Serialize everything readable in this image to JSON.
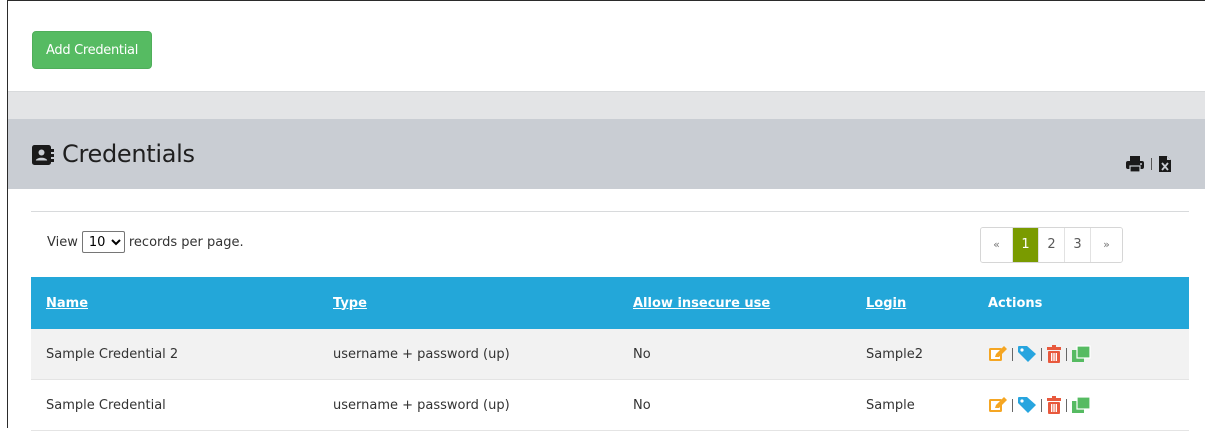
{
  "toolbar": {
    "add_label": "Add Credential"
  },
  "panel": {
    "title": "Credentials",
    "title_icon": "address-book-icon",
    "print_icon": "print-icon",
    "excel_icon": "excel-file-icon"
  },
  "records": {
    "prefix": "View",
    "selected": "10",
    "suffix": "records per page."
  },
  "pagination": {
    "prev": "«",
    "pages": [
      "1",
      "2",
      "3"
    ],
    "active": "1",
    "next": "»",
    "active_color": "#7a9b00"
  },
  "table": {
    "columns": [
      "Name",
      "Type",
      "Allow insecure use",
      "Login",
      "Actions"
    ],
    "rows": [
      {
        "name": "Sample Credential 2",
        "type": "username + password (up)",
        "insecure": "No",
        "login": "Sample2"
      },
      {
        "name": "Sample Credential",
        "type": "username + password (up)",
        "insecure": "No",
        "login": "Sample"
      }
    ],
    "action_icons": [
      "edit-icon",
      "tag-icon",
      "delete-icon",
      "clone-icon"
    ],
    "header_color": "#23a7d9"
  },
  "colors": {
    "add_button": "#56bb62",
    "edit": "#f5a623",
    "tag": "#27a5df",
    "delete": "#e8593d",
    "clone": "#56bb62"
  }
}
